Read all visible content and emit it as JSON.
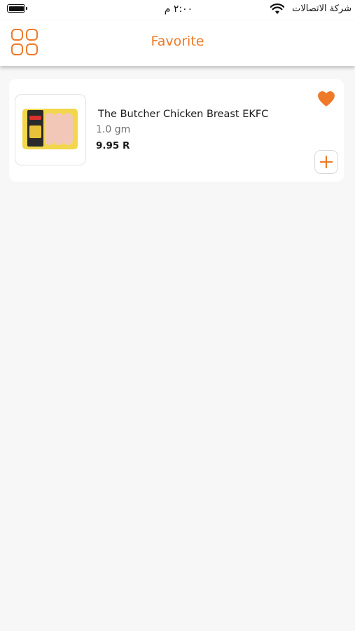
{
  "status_bar": {
    "carrier": "شركة الاتصالات",
    "time": "٢:٠٠ م",
    "wifi_icon": "wifi-icon",
    "battery_icon": "battery-icon"
  },
  "header": {
    "title": "Favorite",
    "menu_icon": "grid-icon",
    "accent_color": "#ee7a29"
  },
  "favorites": [
    {
      "name": "The Butcher Chicken Breast EKFC",
      "weight": "1.0 gm",
      "price": "9.95 R",
      "favorite_icon": "heart-icon",
      "favorited": true,
      "add_icon": "plus-icon"
    }
  ]
}
